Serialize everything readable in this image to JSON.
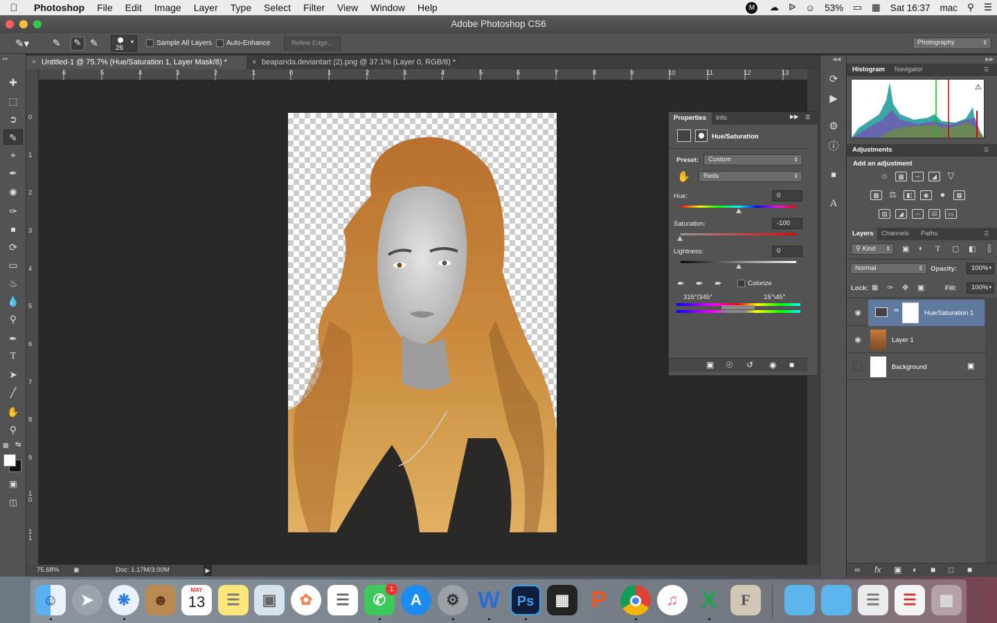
{
  "menubar": {
    "app": "Photoshop",
    "items": [
      "File",
      "Edit",
      "Image",
      "Layer",
      "Type",
      "Select",
      "Filter",
      "View",
      "Window",
      "Help"
    ],
    "battery": "53%",
    "datetime": "Sat 16:37",
    "user": "mac"
  },
  "window": {
    "title": "Adobe Photoshop CS6"
  },
  "options": {
    "brush_size": "26",
    "sample_all_layers": "Sample All Layers",
    "auto_enhance": "Auto-Enhance",
    "refine_edge": "Refine Edge...",
    "workspace": "Photography"
  },
  "tabs": [
    {
      "label": "Untitled-1 @ 75.7% (Hue/Saturation 1, Layer Mask/8) *"
    },
    {
      "label": "beapanda.deviantart (2).png @ 37.1% (Layer 0, RGB/8) *"
    }
  ],
  "ruler": {
    "h": [
      "6",
      "5",
      "4",
      "3",
      "2",
      "1",
      "0",
      "1",
      "2",
      "3",
      "4",
      "5",
      "6",
      "7",
      "8",
      "9",
      "10",
      "11",
      "12",
      "13"
    ],
    "v": [
      "0",
      "1",
      "2",
      "3",
      "4",
      "5",
      "6",
      "7",
      "8",
      "9",
      "1\n0",
      "1\n1"
    ]
  },
  "status": {
    "zoom": "75.68%",
    "doc": "Doc: 1.17M/3.00M"
  },
  "properties": {
    "tab_properties": "Properties",
    "tab_info": "Info",
    "title": "Hue/Saturation",
    "preset_label": "Preset:",
    "preset_value": "Custom",
    "channel_value": "Reds",
    "hue_label": "Hue:",
    "hue_value": "0",
    "saturation_label": "Saturation:",
    "saturation_value": "-100",
    "lightness_label": "Lightness:",
    "lightness_value": "0",
    "colorize": "Colorize",
    "range_left": "315°/345°",
    "range_right": "15°\\45°"
  },
  "histogram": {
    "tab_histogram": "Histogram",
    "tab_navigator": "Navigator"
  },
  "adjustments": {
    "tab": "Adjustments",
    "subtitle": "Add an adjustment"
  },
  "layers": {
    "tab_layers": "Layers",
    "tab_channels": "Channels",
    "tab_paths": "Paths",
    "kind": "Kind",
    "blend": "Normal",
    "opacity_label": "Opacity:",
    "opacity": "100%",
    "lock_label": "Lock:",
    "fill_label": "Fill:",
    "fill": "100%",
    "items": [
      {
        "name": "Hue/Saturation 1"
      },
      {
        "name": "Layer 1"
      },
      {
        "name": "Background"
      }
    ]
  },
  "dock": {
    "calendar_month": "MAY",
    "calendar_day": "13",
    "facetime_badge": "1"
  },
  "colors": {
    "accent_selected_layer": "#5f7a9e",
    "panel_bg": "#535353",
    "canvas_bg": "#282828"
  }
}
